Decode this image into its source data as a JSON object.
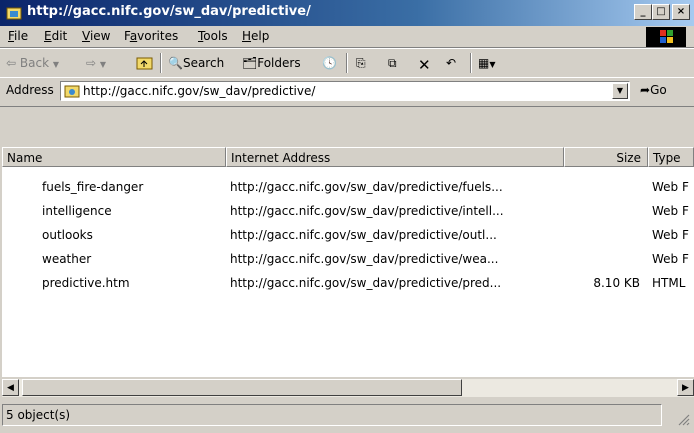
{
  "window": {
    "title": "http://gacc.nifc.gov/sw_dav/predictive/",
    "minimize": "_",
    "maximize": "□",
    "close": "×"
  },
  "menu": [
    "File",
    "Edit",
    "View",
    "Favorites",
    "Tools",
    "Help"
  ],
  "menu_underline": [
    "F",
    "E",
    "V",
    "a",
    "T",
    "H"
  ],
  "toolbar": {
    "back": "Back",
    "search": "Search",
    "folders": "Folders"
  },
  "address": {
    "label": "Address",
    "value": "http://gacc.nifc.gov/sw_dav/predictive/",
    "go": "Go"
  },
  "columns": [
    "Name",
    "Internet Address",
    "Size",
    "Type"
  ],
  "rows": [
    {
      "icon": "folder-icon",
      "name": "fuels_fire-danger",
      "address": "http://gacc.nifc.gov/sw_dav/predictive/fuels...",
      "size": "",
      "type": "Web F"
    },
    {
      "icon": "folder-icon",
      "name": "intelligence",
      "address": "http://gacc.nifc.gov/sw_dav/predictive/intell...",
      "size": "",
      "type": "Web F"
    },
    {
      "icon": "folder-icon",
      "name": "outlooks",
      "address": "http://gacc.nifc.gov/sw_dav/predictive/outl...",
      "size": "",
      "type": "Web F"
    },
    {
      "icon": "folder-icon",
      "name": "weather",
      "address": "http://gacc.nifc.gov/sw_dav/predictive/wea...",
      "size": "",
      "type": "Web F"
    },
    {
      "icon": "ie-page-icon",
      "name": "predictive.htm",
      "address": "http://gacc.nifc.gov/sw_dav/predictive/pred...",
      "size": "8.10 KB",
      "type": "HTML"
    }
  ],
  "status": "5 object(s)"
}
